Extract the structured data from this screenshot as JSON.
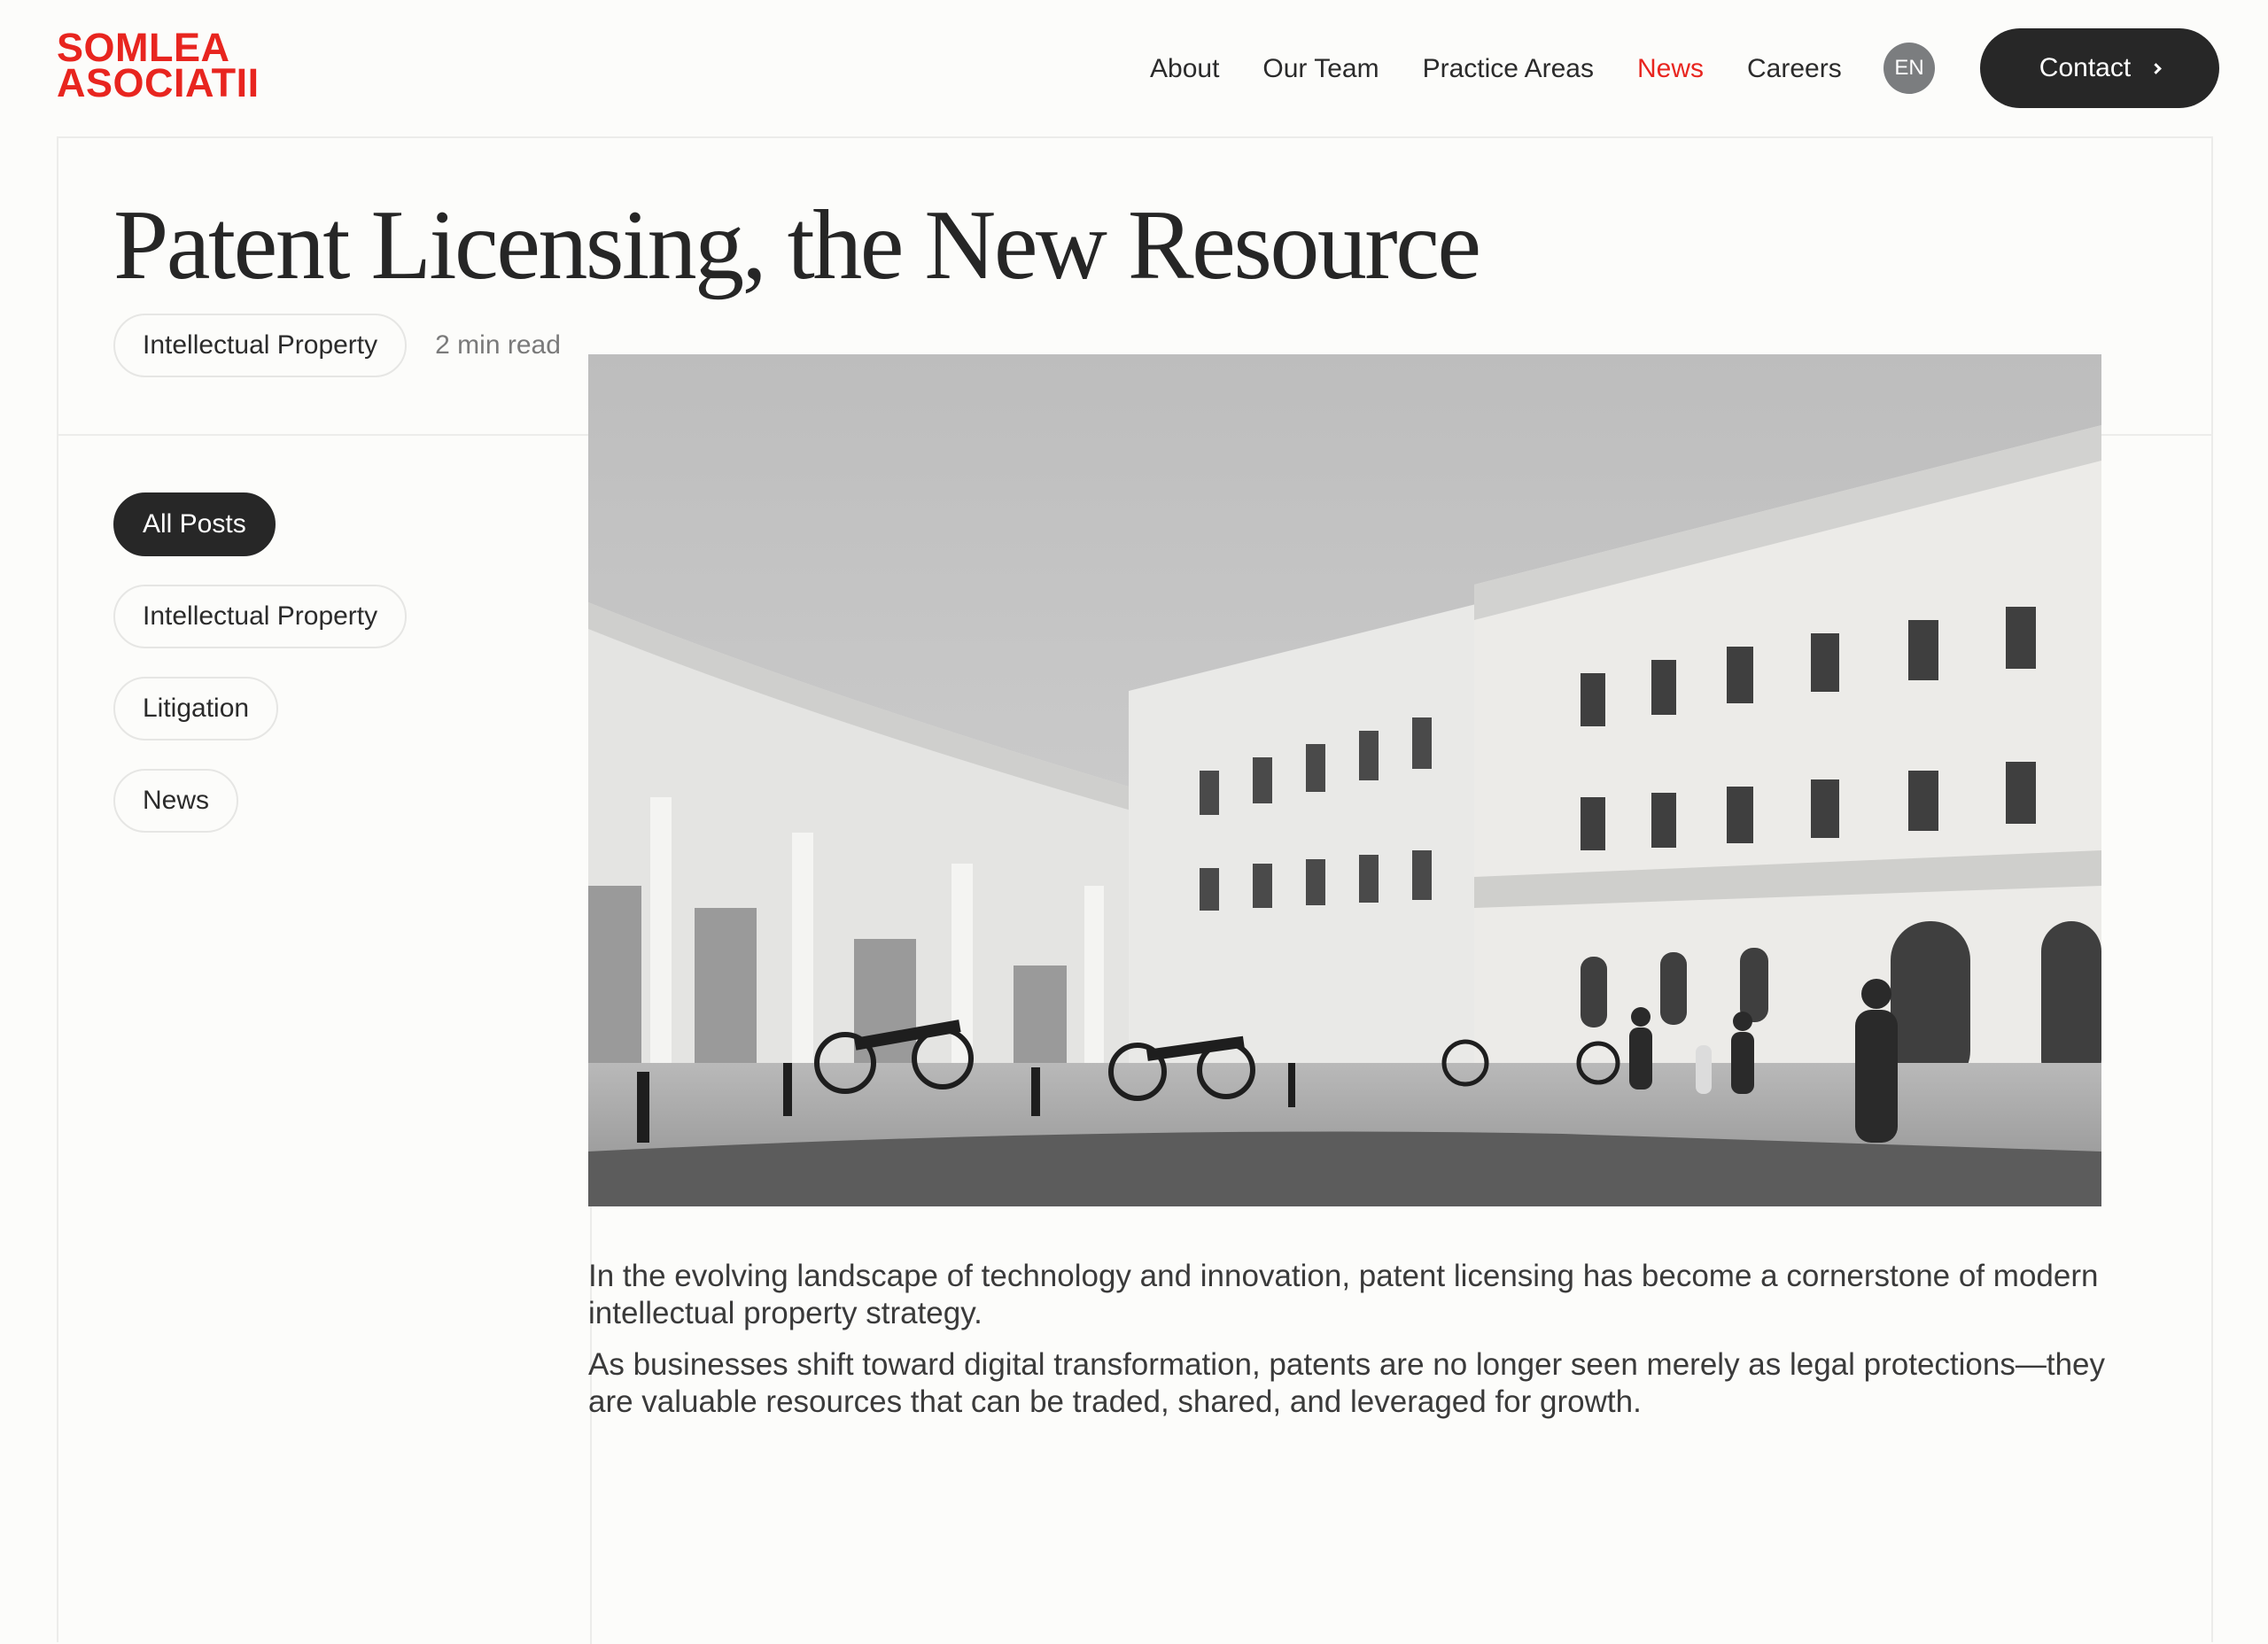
{
  "logo": {
    "line1": "SOMLEA",
    "line2": "ASOCIATII",
    "color": "#e8251f"
  },
  "nav": {
    "items": [
      {
        "label": "About",
        "active": false
      },
      {
        "label": "Our Team",
        "active": false
      },
      {
        "label": "Practice Areas",
        "active": false
      },
      {
        "label": "News",
        "active": true
      },
      {
        "label": "Careers",
        "active": false
      }
    ],
    "language": "EN",
    "contact_label": "Contact",
    "contact_icon": "chevron-right-icon"
  },
  "post": {
    "title": "Patent Licensing, the New Resource",
    "category": "Intellectual Property",
    "read_time": "2 min read"
  },
  "sidebar": {
    "filters": [
      {
        "label": "All Posts",
        "selected": true
      },
      {
        "label": "Intellectual Property",
        "selected": false
      },
      {
        "label": "Litigation",
        "selected": false
      },
      {
        "label": "News",
        "selected": false
      }
    ]
  },
  "article": {
    "hero_image": "black-and-white photo of a palace courtyard with cannons and pedestrians",
    "paragraphs": [
      "In the evolving landscape of technology and innovation, patent licensing has become a cornerstone of modern intellectual property strategy.",
      "As businesses shift toward digital transformation, patents are no longer seen merely as legal protections—they are valuable resources that can be traded, shared, and leveraged for growth."
    ]
  },
  "colors": {
    "accent": "#e8251f",
    "dark_button": "#272727",
    "background": "#fcfcfa",
    "border": "#ececea"
  }
}
